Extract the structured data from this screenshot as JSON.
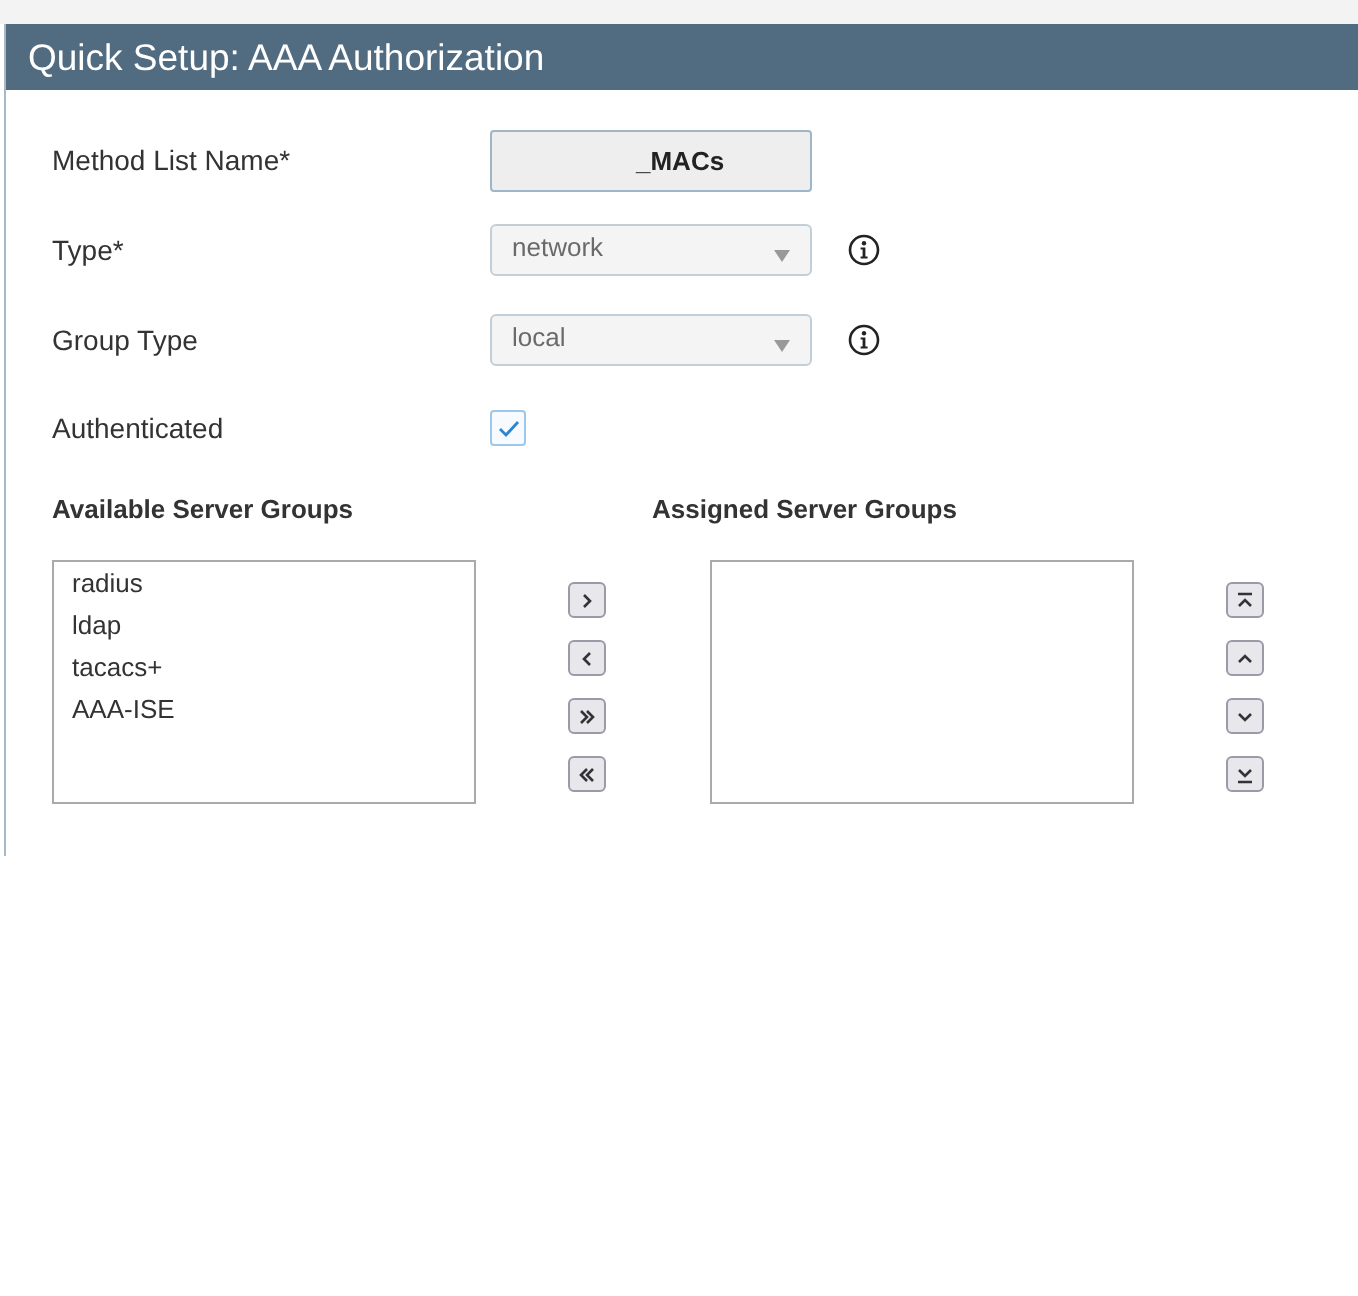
{
  "window": {
    "title": "Quick Setup: AAA Authorization"
  },
  "fields": [
    {
      "kind": "text",
      "label": "Method List Name*",
      "value": "_MACs"
    },
    {
      "kind": "select",
      "label": "Type*",
      "value": "network",
      "info": true
    },
    {
      "kind": "select",
      "label": "Group Type",
      "value": "local",
      "info": true
    },
    {
      "kind": "checkbox",
      "label": "Authenticated",
      "checked": true
    }
  ],
  "available_server_groups": {
    "heading": "Available Server Groups",
    "items": [
      {
        "label": "radius",
        "selected": false
      },
      {
        "label": "ldap",
        "selected": false
      },
      {
        "label": "tacacs+",
        "selected": false
      },
      {
        "label": "AAA-ISE",
        "selected": false
      }
    ]
  },
  "assigned_server_groups": {
    "heading": "Assigned Server Groups"
  }
}
